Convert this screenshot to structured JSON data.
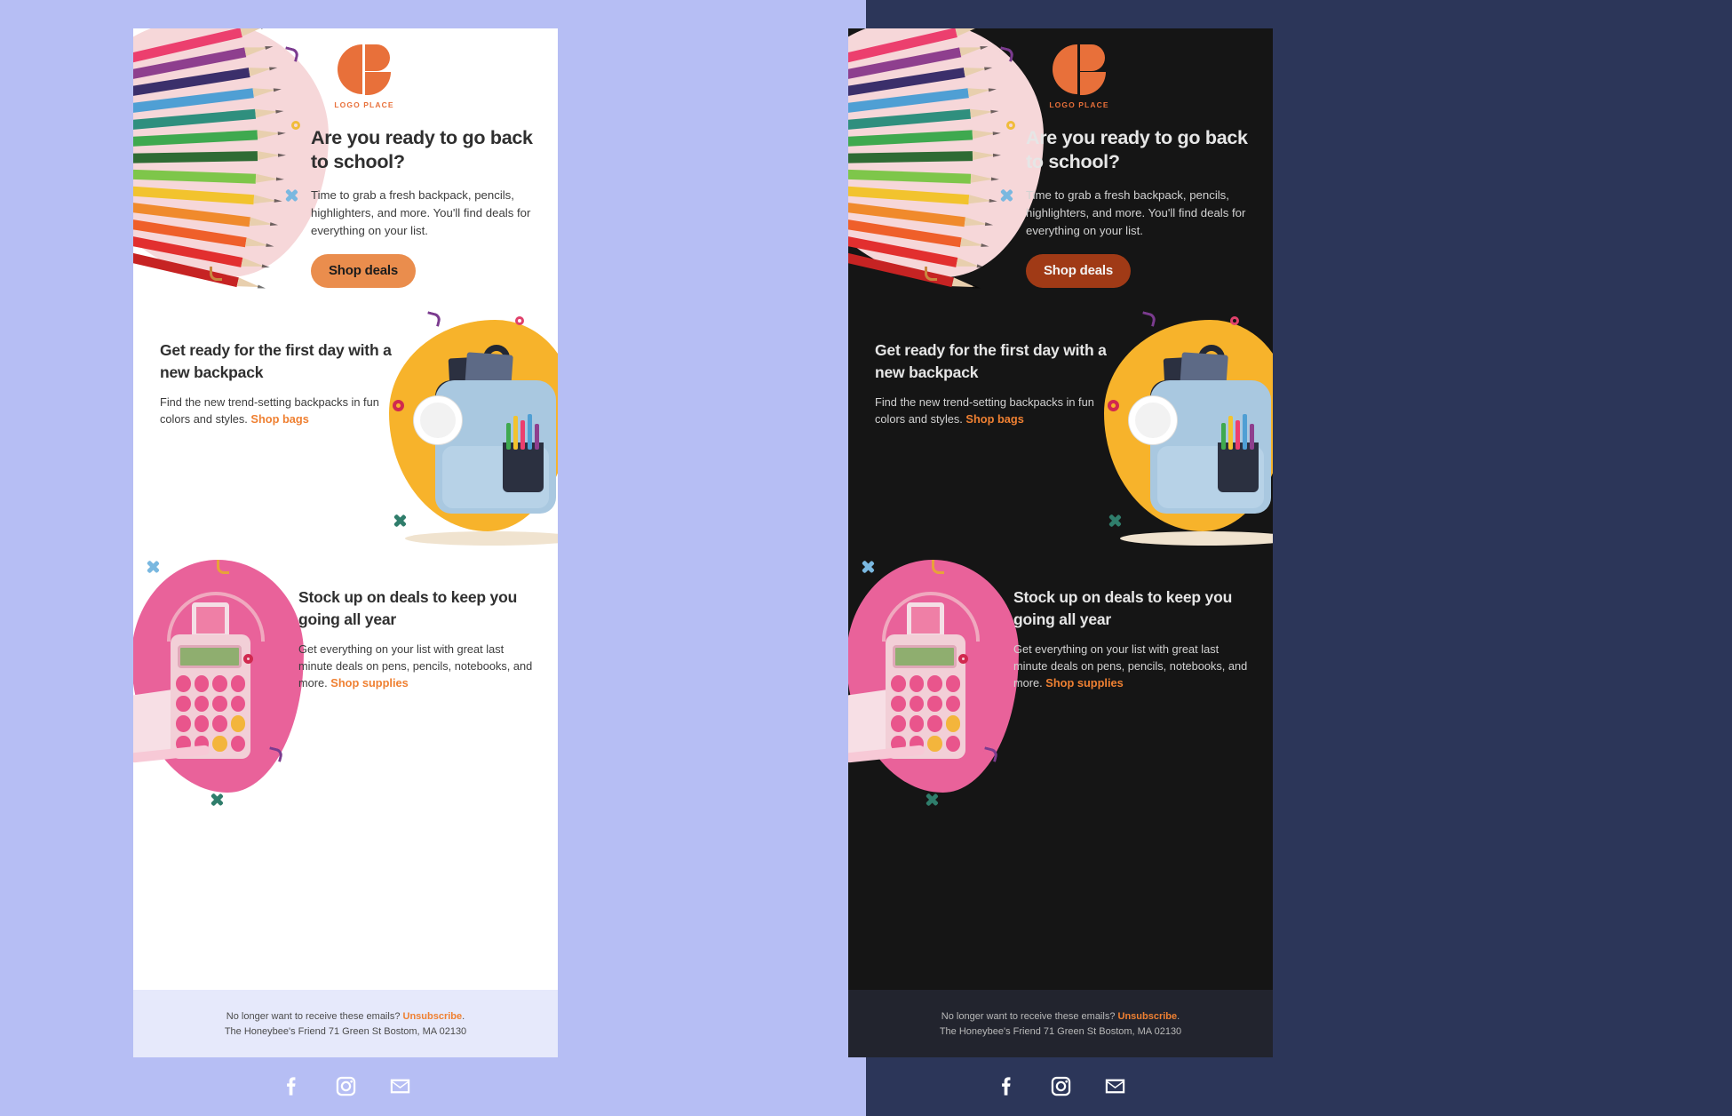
{
  "variants": [
    {
      "name": "light-mode-preview",
      "background": "#b6bef4",
      "card_bg": "#ffffff"
    },
    {
      "name": "dark-mode-preview",
      "background": "#2c3659",
      "card_bg": "#151515"
    }
  ],
  "colors": {
    "accent_orange": "#ef8032",
    "button_light": "#ea8d4d",
    "button_dark": "#a03a16",
    "logo_orange": "#e8703a",
    "light_stage": "#b6bef4",
    "dark_stage": "#2c3659",
    "footer_light": "#e6e9fb",
    "footer_dark": "#22242e"
  },
  "email": {
    "logo": {
      "label": "LOGO PLACE",
      "icon": "leaf-logo-mark"
    },
    "hero": {
      "headline": "Are you ready to go back to school?",
      "body": "Time to grab a fresh backpack, pencils, highlighters, and more. You'll find deals for everything on your list.",
      "cta": "Shop deals",
      "image_alt": "colored-pencils-photo"
    },
    "section_backpack": {
      "headline": "Get ready for the first day with a new backpack",
      "body": "Find the new trend-setting backpacks in fun colors and styles. ",
      "link": "Shop bags",
      "image_alt": "blue-backpack-photo"
    },
    "section_supplies": {
      "headline": "Stock up on deals to keep you going all year",
      "body": "Get everything on your list with great last minute deals on pens, pencils, notebooks, and more. ",
      "link": "Shop supplies",
      "image_alt": "pink-calculator-photo"
    },
    "footer": {
      "unsub_prefix": "No longer want to receive these emails? ",
      "unsub_link": "Unsubscribe",
      "unsub_suffix": ".",
      "address": "The Honeybee's Friend 71 Green St Bostom, MA 02130",
      "social": [
        {
          "name": "facebook-icon"
        },
        {
          "name": "instagram-icon"
        },
        {
          "name": "email-icon"
        }
      ]
    }
  }
}
